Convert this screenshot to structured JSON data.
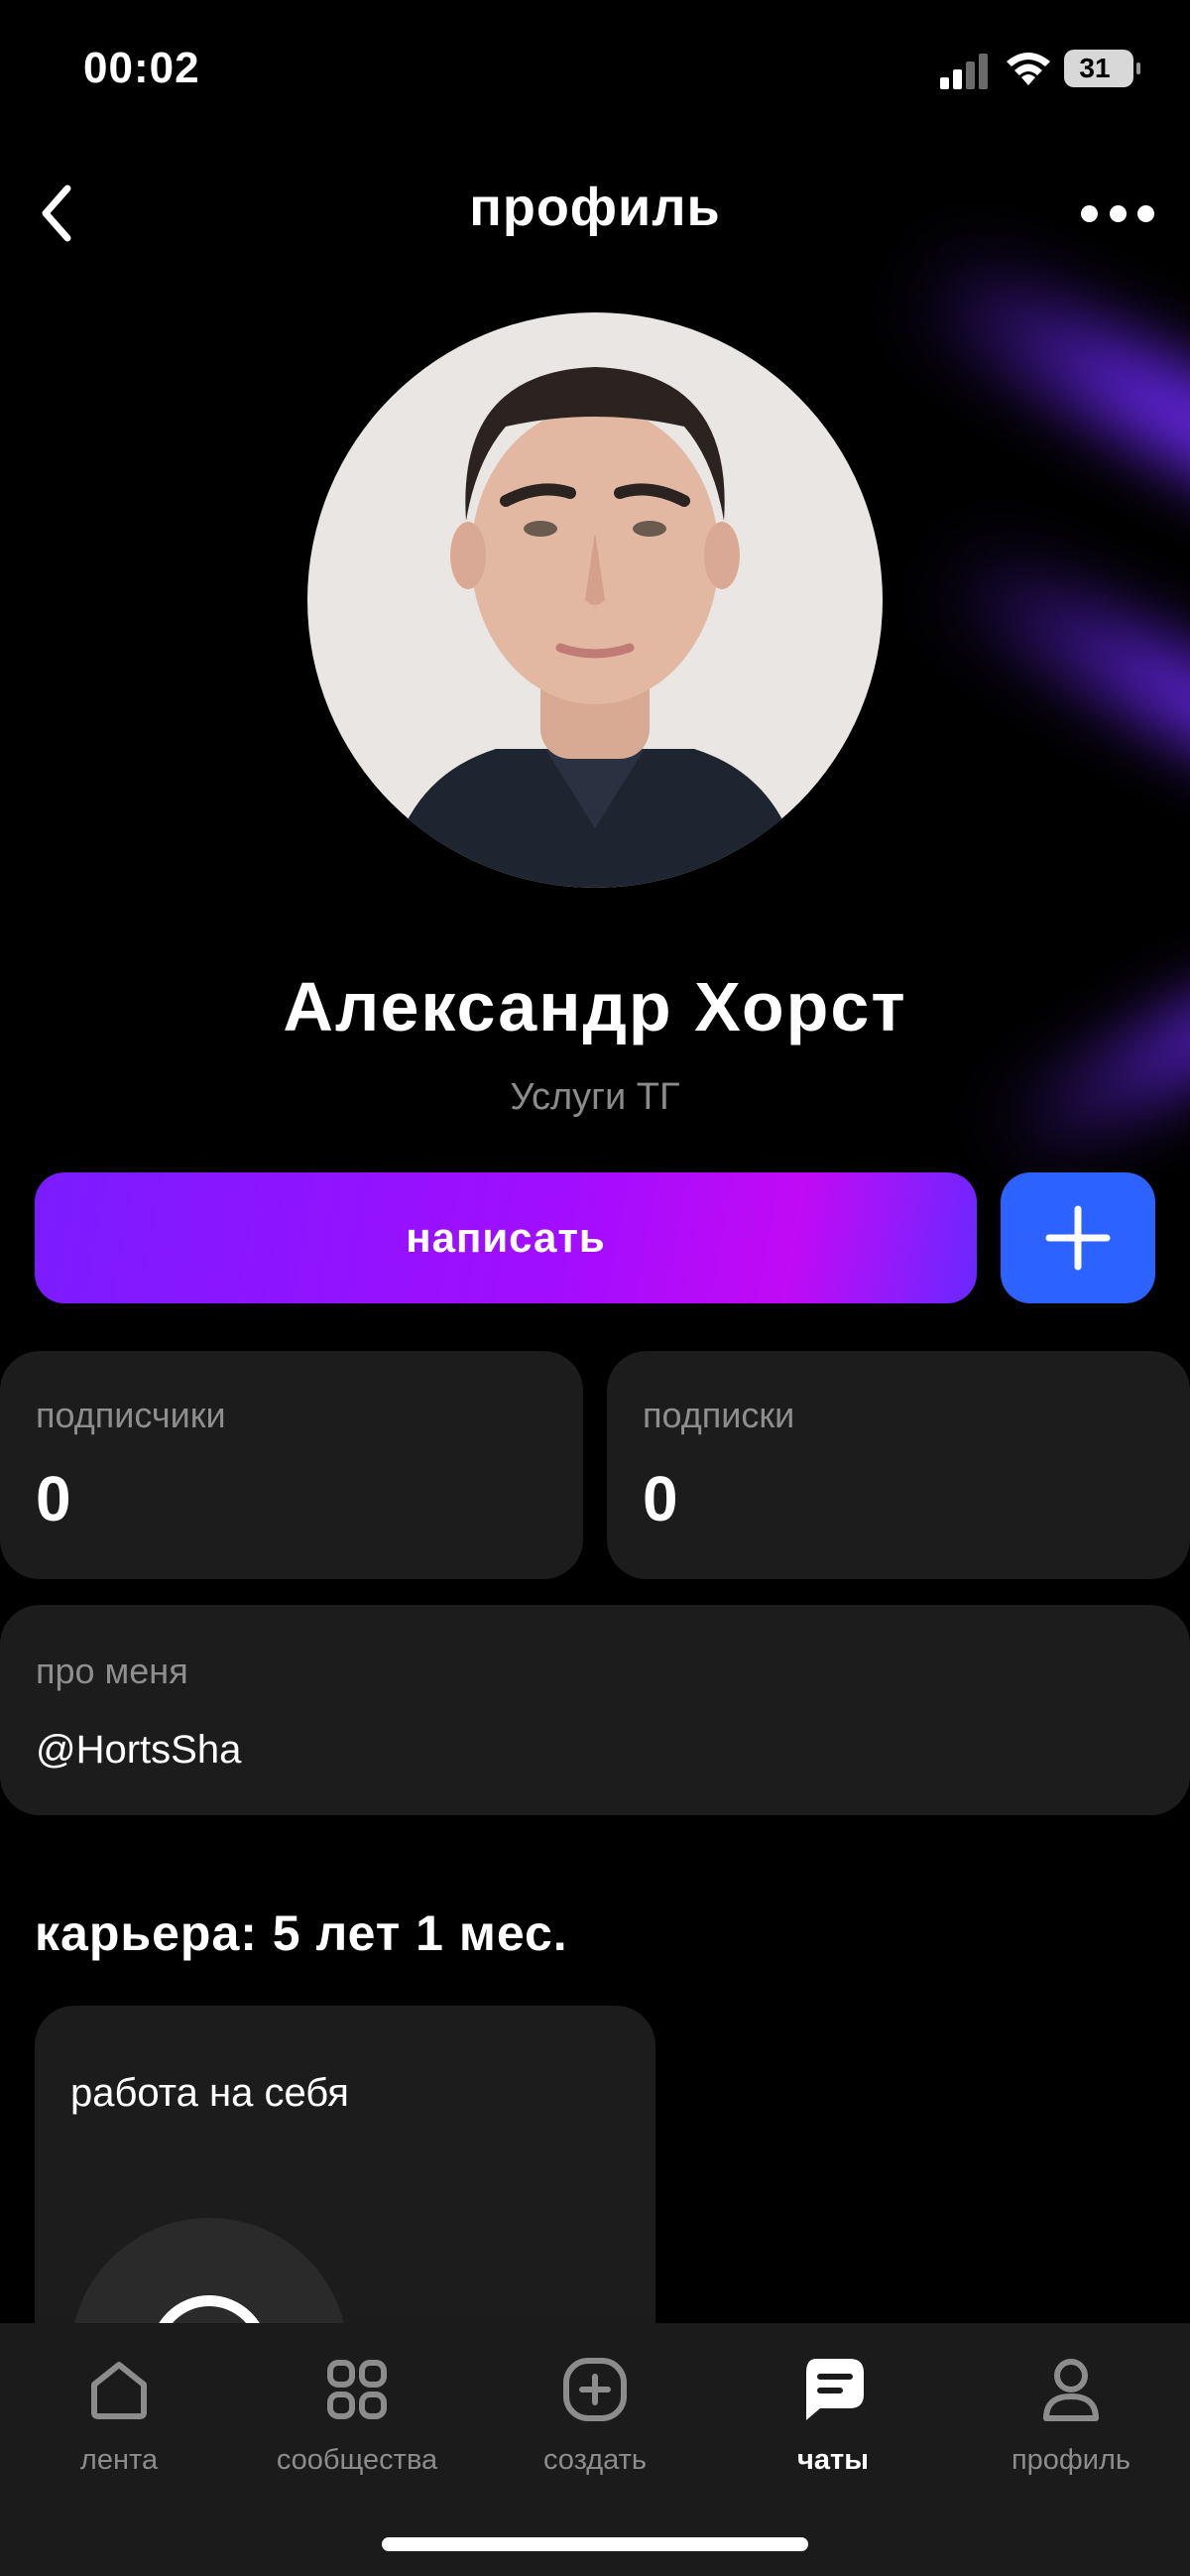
{
  "status_bar": {
    "time": "00:02",
    "battery": "31"
  },
  "header": {
    "title": "профиль"
  },
  "profile": {
    "name": "Александр Хорст",
    "subtitle": "Услуги ТГ",
    "write_label": "написать"
  },
  "stats": {
    "followers_label": "подписчики",
    "followers_value": "0",
    "following_label": "подписки",
    "following_value": "0"
  },
  "about": {
    "label": "про меня",
    "text": "@HortsSha"
  },
  "career": {
    "title": "карьера: 5 лет 1 мес.",
    "job_label": "работа на себя"
  },
  "tabbar": {
    "items": [
      {
        "label": "лента",
        "icon": "home-icon"
      },
      {
        "label": "сообщества",
        "icon": "grid-icon"
      },
      {
        "label": "создать",
        "icon": "plus-square-icon"
      },
      {
        "label": "чаты",
        "icon": "chat-icon"
      },
      {
        "label": "профиль",
        "icon": "user-icon"
      }
    ],
    "active": "чаты"
  },
  "colors": {
    "background": "#000000",
    "card": "#1c1c1c",
    "accent_purple": "#9b12ff",
    "accent_blue": "#2c62ff",
    "muted_text": "#8e8e8e"
  }
}
